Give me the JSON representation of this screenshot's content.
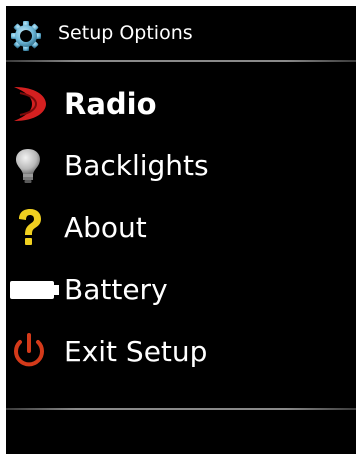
{
  "header": {
    "title": "Setup Options",
    "icon": "gear-icon"
  },
  "menu": {
    "selected_index": 0,
    "items": [
      {
        "label": "Radio",
        "icon": "radio-icon",
        "color": "#d42020"
      },
      {
        "label": "Backlights",
        "icon": "lightbulb-icon",
        "color": "#c8c8c8"
      },
      {
        "label": "About",
        "icon": "question-mark-icon",
        "color": "#f0d020"
      },
      {
        "label": "Battery",
        "icon": "battery-icon",
        "color": "#ffffff"
      },
      {
        "label": "Exit Setup",
        "icon": "power-icon",
        "color": "#d43a1a"
      }
    ]
  },
  "colors": {
    "background": "#000000",
    "text": "#ffffff",
    "gear": "#6fb8d8"
  }
}
